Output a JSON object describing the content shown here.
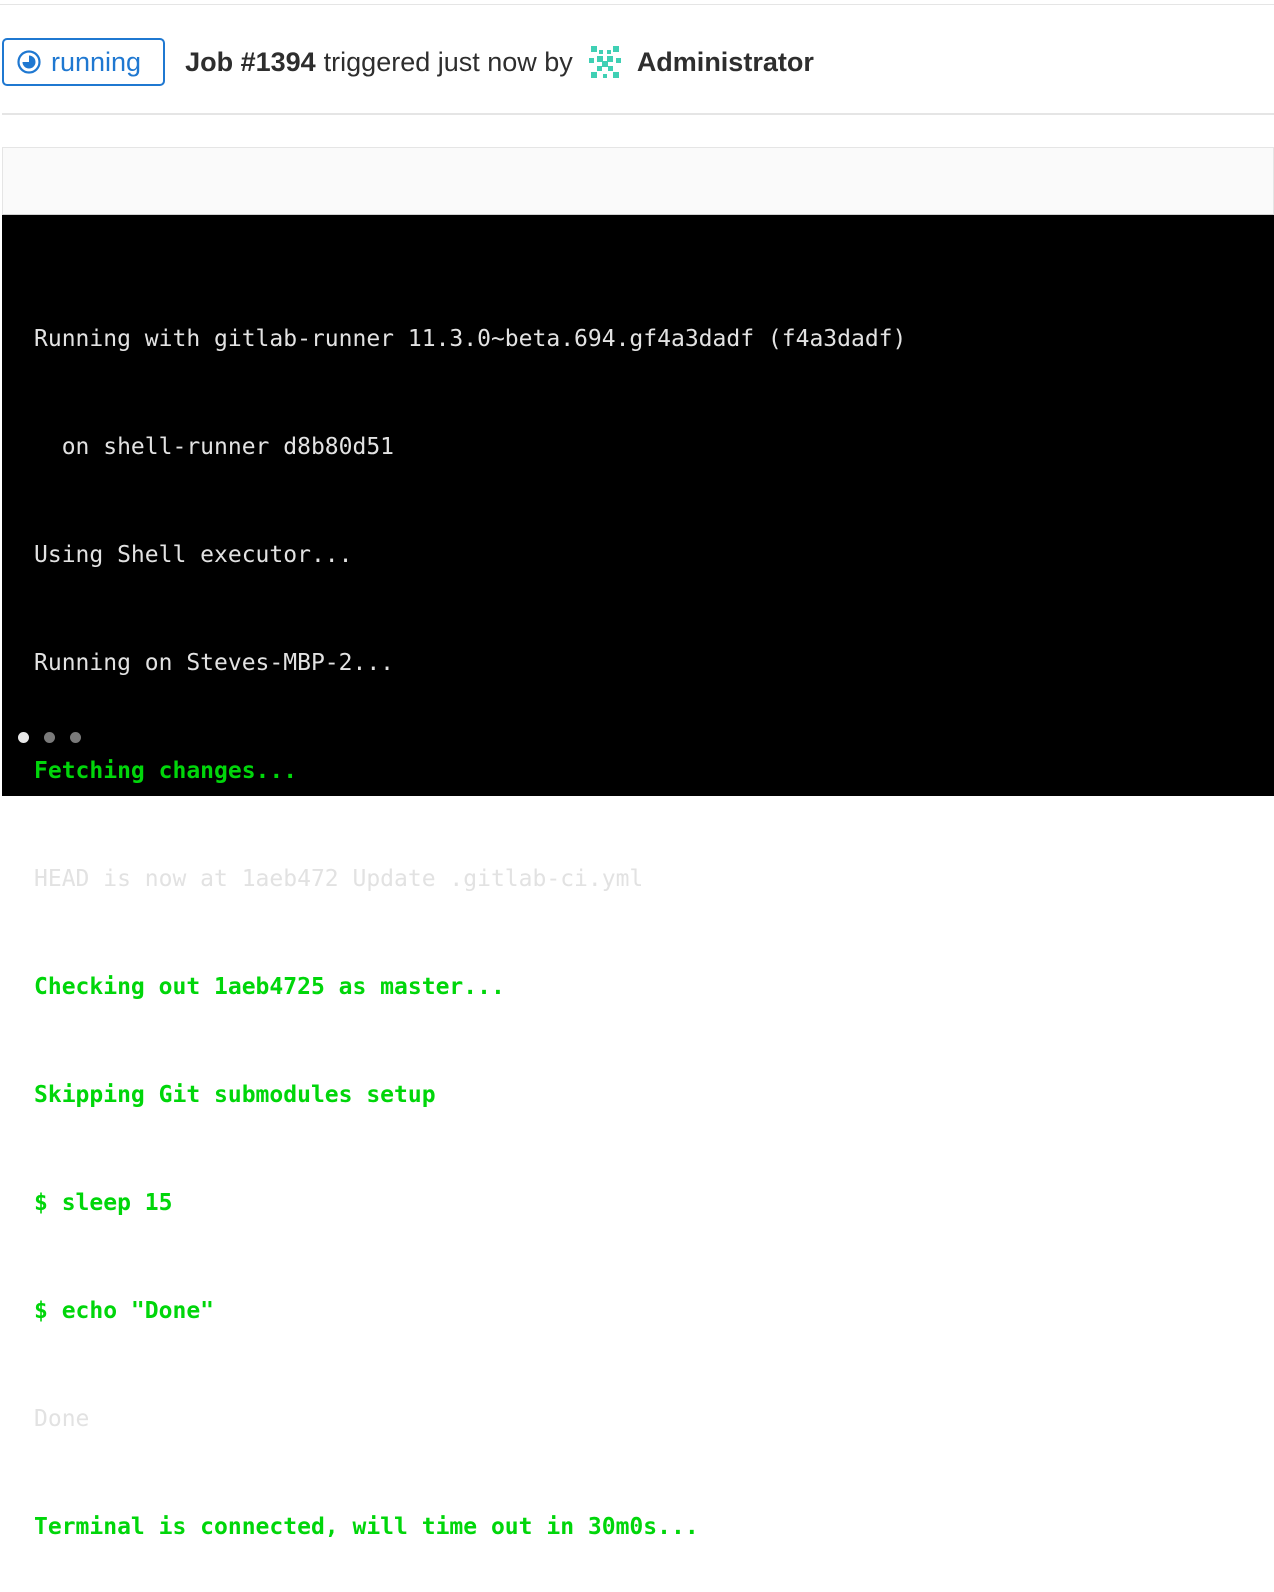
{
  "header": {
    "status": "running",
    "job_title": "Job #1394",
    "triggered_text": "triggered just now by",
    "user": "Administrator"
  },
  "colors": {
    "status_blue": "#1f78d1",
    "log_green": "#00d60a",
    "log_text": "#e2e2e2",
    "terminal_bg": "#000000"
  },
  "icons": {
    "status": "status-running-icon",
    "avatar": "identicon-avatar"
  },
  "log": {
    "lines": [
      {
        "text": "Running with gitlab-runner 11.3.0~beta.694.gf4a3dadf (f4a3dadf)",
        "style": "normal"
      },
      {
        "text": "  on shell-runner d8b80d51",
        "style": "normal"
      },
      {
        "text": "Using Shell executor...",
        "style": "normal"
      },
      {
        "text": "Running on Steves-MBP-2...",
        "style": "normal"
      },
      {
        "text": "Fetching changes...",
        "style": "green"
      },
      {
        "text": "HEAD is now at 1aeb472 Update .gitlab-ci.yml",
        "style": "normal"
      },
      {
        "text": "Checking out 1aeb4725 as master...",
        "style": "green"
      },
      {
        "text": "Skipping Git submodules setup",
        "style": "green"
      },
      {
        "text": "$ sleep 15",
        "style": "green"
      },
      {
        "text": "$ echo \"Done\"",
        "style": "green"
      },
      {
        "text": "Done",
        "style": "normal"
      },
      {
        "text": "Terminal is connected, will time out in 30m0s...",
        "style": "green"
      }
    ]
  }
}
